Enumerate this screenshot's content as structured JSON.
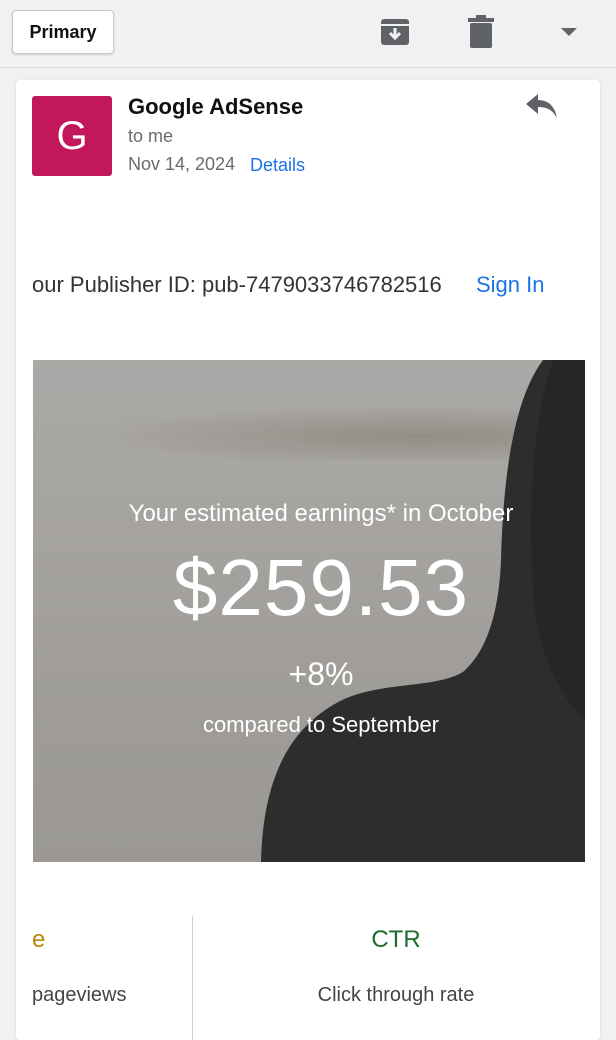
{
  "toolbar": {
    "primary_label": "Primary",
    "archive_icon": "archive-icon",
    "delete_icon": "trash-icon",
    "more_icon": "chevron-down-icon"
  },
  "email": {
    "avatar_letter": "G",
    "sender": "Google AdSense",
    "to": "to me",
    "date": "Nov 14, 2024",
    "details_label": "Details",
    "reply_icon": "reply-icon",
    "publisher_text": "our Publisher ID: pub-7479033746782516",
    "signin_label": "Sign In"
  },
  "hero": {
    "caption": "Your estimated earnings* in October",
    "amount": "$259.53",
    "change": "+8%",
    "compare": "compared to September"
  },
  "stats": {
    "left_value": "e",
    "left_label": "pageviews",
    "right_value": "CTR",
    "right_label": "Click through rate"
  },
  "colors": {
    "avatar": "#c2185b",
    "link": "#1a73e8",
    "ctr": "#1e6b2a",
    "accent_left": "#b8860b"
  }
}
